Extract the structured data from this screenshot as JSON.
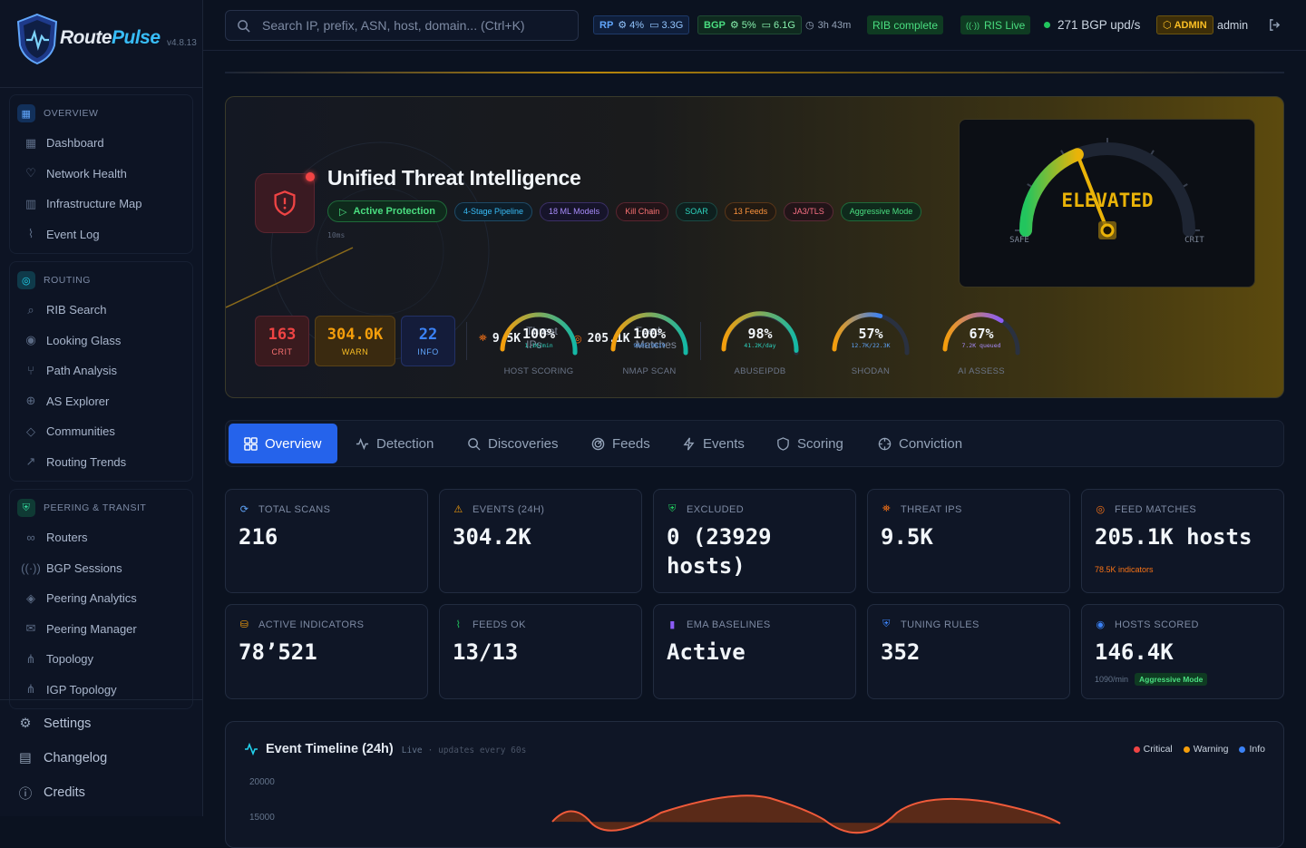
{
  "brand": {
    "name_a": "Route",
    "name_b": "Pulse",
    "version": "v4.8.13"
  },
  "sidebar": {
    "overview": {
      "title": "OVERVIEW",
      "items": [
        "Dashboard",
        "Network Health",
        "Infrastructure Map",
        "Event Log"
      ]
    },
    "routing": {
      "title": "ROUTING",
      "items": [
        "RIB Search",
        "Looking Glass",
        "Path Analysis",
        "AS Explorer",
        "Communities",
        "Routing Trends"
      ]
    },
    "peering": {
      "title": "PEERING & TRANSIT",
      "items": [
        "Routers",
        "BGP Sessions",
        "Peering Analytics",
        "Peering Manager",
        "Topology",
        "IGP Topology"
      ]
    },
    "bottom": [
      "Settings",
      "Changelog",
      "Credits"
    ]
  },
  "topbar": {
    "search_placeholder": "Search IP, prefix, ASN, host, domain... (Ctrl+K)",
    "rp": {
      "label": "RP",
      "cpu": "4%",
      "mem": "3.3G"
    },
    "bgp": {
      "label": "BGP",
      "cpu": "5%",
      "mem": "6.1G"
    },
    "uptime": "3h 43m",
    "rib": "RIB complete",
    "ris": "RIS Live",
    "bgp_rate": "271 BGP upd/s",
    "role": "ADMIN",
    "user": "admin"
  },
  "hero": {
    "title": "Unified Threat Intelligence",
    "active": "Active Protection",
    "pills": [
      "4-Stage Pipeline",
      "18 ML Models",
      "Kill Chain",
      "SOAR",
      "13 Feeds",
      "JA3/TLS",
      "Aggressive Mode"
    ],
    "latency": "10ms",
    "severity": [
      {
        "n": "163",
        "l": "CRIT"
      },
      {
        "n": "304.0K",
        "l": "WARN"
      },
      {
        "n": "22",
        "l": "INFO"
      }
    ],
    "threat_ips": {
      "value": "9.5K",
      "label_a": "Threat",
      "label_b": "IPs"
    },
    "feed_matches": {
      "value": "205.1K",
      "label_a": "Feed",
      "label_b": "Matches"
    },
    "rings": [
      {
        "pct": "100%",
        "sub": "1.1K/min",
        "name": "HOST SCORING",
        "fill": 1.0,
        "color": "#14b8a6",
        "subcolor": "#2dd4bf"
      },
      {
        "pct": "100%",
        "sub": "9605/9619",
        "name": "NMAP SCAN",
        "fill": 1.0,
        "color": "#14b8a6",
        "subcolor": "#60a5fa"
      },
      {
        "pct": "98%",
        "sub": "41.2K/day",
        "name": "ABUSEIPDB",
        "fill": 0.98,
        "color": "#14b8a6",
        "subcolor": "#2dd4bf"
      },
      {
        "pct": "57%",
        "sub": "12.7K/22.3K",
        "name": "SHODAN",
        "fill": 0.57,
        "color": "#3b82f6",
        "subcolor": "#60a5fa"
      },
      {
        "pct": "67%",
        "sub": "7.2K queued",
        "name": "AI ASSESS",
        "fill": 0.67,
        "color": "#8b5cf6",
        "subcolor": "#a78bfa"
      }
    ],
    "gauge": {
      "label": "ELEVATED",
      "safe": "SAFE",
      "crit": "CRIT",
      "level": 0.38
    }
  },
  "tabs": [
    "Overview",
    "Detection",
    "Discoveries",
    "Feeds",
    "Events",
    "Scoring",
    "Conviction"
  ],
  "cards": [
    {
      "title": "TOTAL SCANS",
      "value": "216",
      "icon": "refresh-icon",
      "color": "#60a5fa"
    },
    {
      "title": "EVENTS (24H)",
      "value": "304.2K",
      "icon": "warning-icon",
      "color": "#f59e0b"
    },
    {
      "title": "EXCLUDED",
      "value": "0 (23929 hosts)",
      "icon": "shield-check-icon",
      "color": "#22c55e"
    },
    {
      "title": "THREAT IPS",
      "value": "9.5K",
      "icon": "bug-icon",
      "color": "#f97316"
    },
    {
      "title": "FEED MATCHES",
      "value": "205.1K hosts",
      "icon": "radar-icon",
      "color": "#f97316",
      "sub": "78.5K indicators"
    },
    {
      "title": "ACTIVE INDICATORS",
      "value": "78’521",
      "icon": "database-icon",
      "color": "#f59e0b"
    },
    {
      "title": "FEEDS OK",
      "value": "13/13",
      "icon": "pulse-icon",
      "color": "#22c55e"
    },
    {
      "title": "EMA BASELINES",
      "value": "Active",
      "icon": "bar-chart-icon",
      "color": "#8b5cf6"
    },
    {
      "title": "TUNING RULES",
      "value": "352",
      "icon": "shield-icon",
      "color": "#3b82f6"
    },
    {
      "title": "HOSTS SCORED",
      "value": "146.4K",
      "icon": "eye-icon",
      "color": "#3b82f6",
      "sub": "1090/min",
      "badge": "Aggressive Mode"
    }
  ],
  "timeline": {
    "title": "Event Timeline (24h)",
    "live": "Live",
    "note": "· updates every 60s",
    "legend": [
      "Critical",
      "Warning",
      "Info"
    ],
    "y_top": "20000",
    "y_next": "15000"
  }
}
